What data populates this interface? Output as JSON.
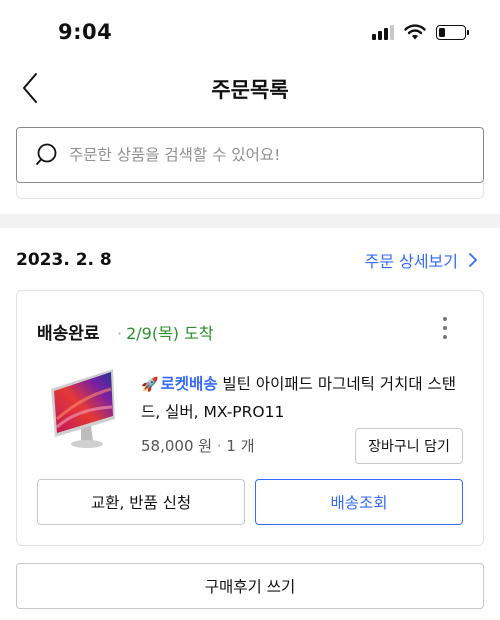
{
  "status_bar": {
    "time": "9:04",
    "icons": [
      "cellular-signal-icon",
      "wifi-icon",
      "battery-icon"
    ],
    "battery_level": 0.25
  },
  "nav": {
    "title": "주문목록",
    "back_icon": "chevron-left-icon"
  },
  "search": {
    "placeholder": "주문한 상품을 검색할 수 있어요!",
    "value": "",
    "icon": "search-icon"
  },
  "order": {
    "date": "2023. 2. 8",
    "detail_link": "주문 상세보기",
    "shipping_status": "배송완료",
    "arrival": "2/9(목) 도착",
    "rocket_badge": "로켓배송",
    "product_name": "빌틴 아이패드 마그네틱 거치대 스탠드, 실버, MX-PRO11",
    "price": "58,000 원",
    "quantity": "1 개",
    "cart_button": "장바구니 담기",
    "exchange_button": "교환, 반품 신청",
    "tracking_button": "배송조회",
    "review_button": "구매후기 쓰기"
  },
  "colors": {
    "accent_blue": "#346aff",
    "arrival_green": "#2b8f2b",
    "divider_gray": "#f2f2f2",
    "border_gray": "#c8c8c8"
  }
}
